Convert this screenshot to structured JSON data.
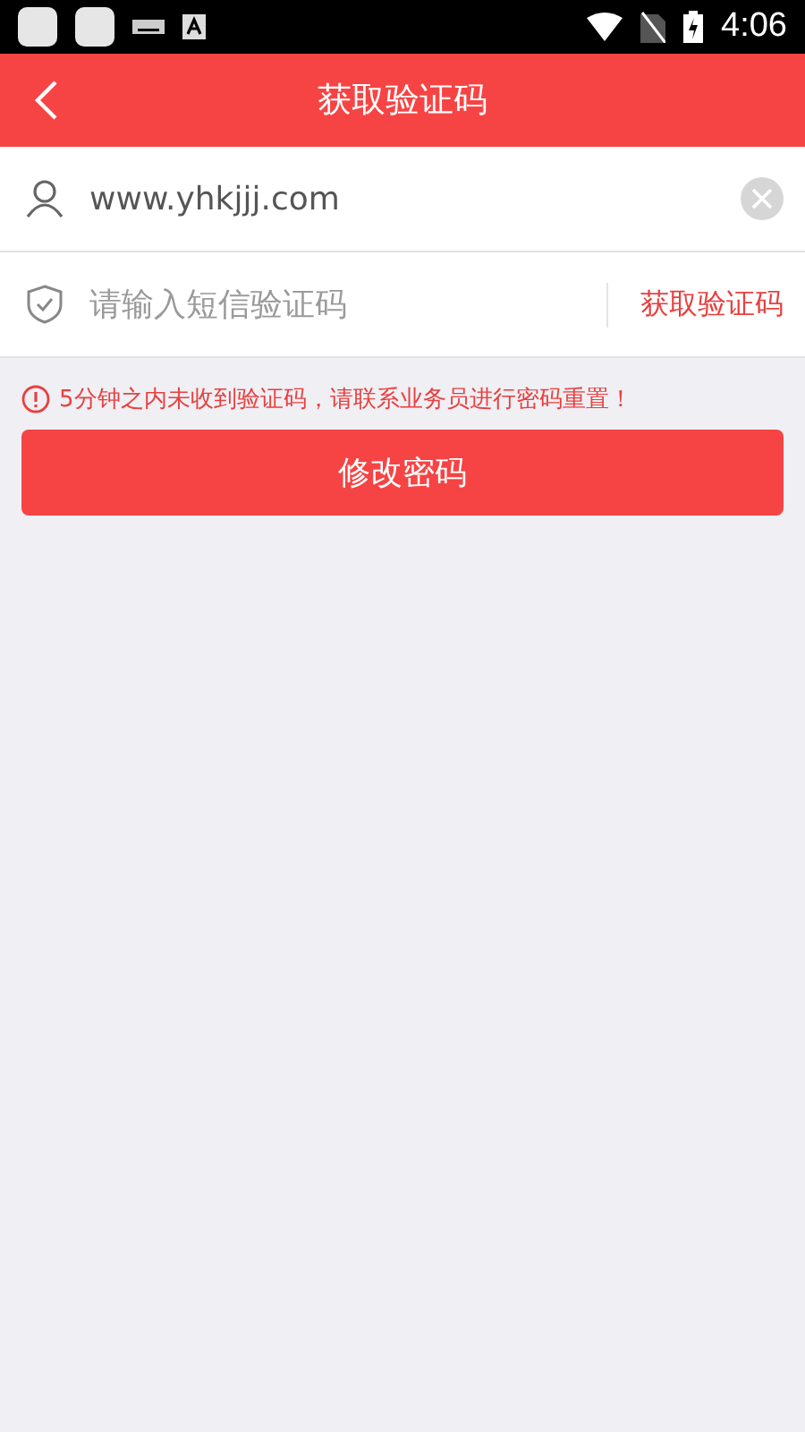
{
  "status_bar": {
    "time": "4:06"
  },
  "header": {
    "title": "获取验证码"
  },
  "account_field": {
    "value": "www.yhkjjj.com"
  },
  "code_field": {
    "placeholder": "请输入短信验证码",
    "action": "获取验证码"
  },
  "notice": "5分钟之内未收到验证码，请联系业务员进行密码重置！",
  "submit_button": "修改密码"
}
